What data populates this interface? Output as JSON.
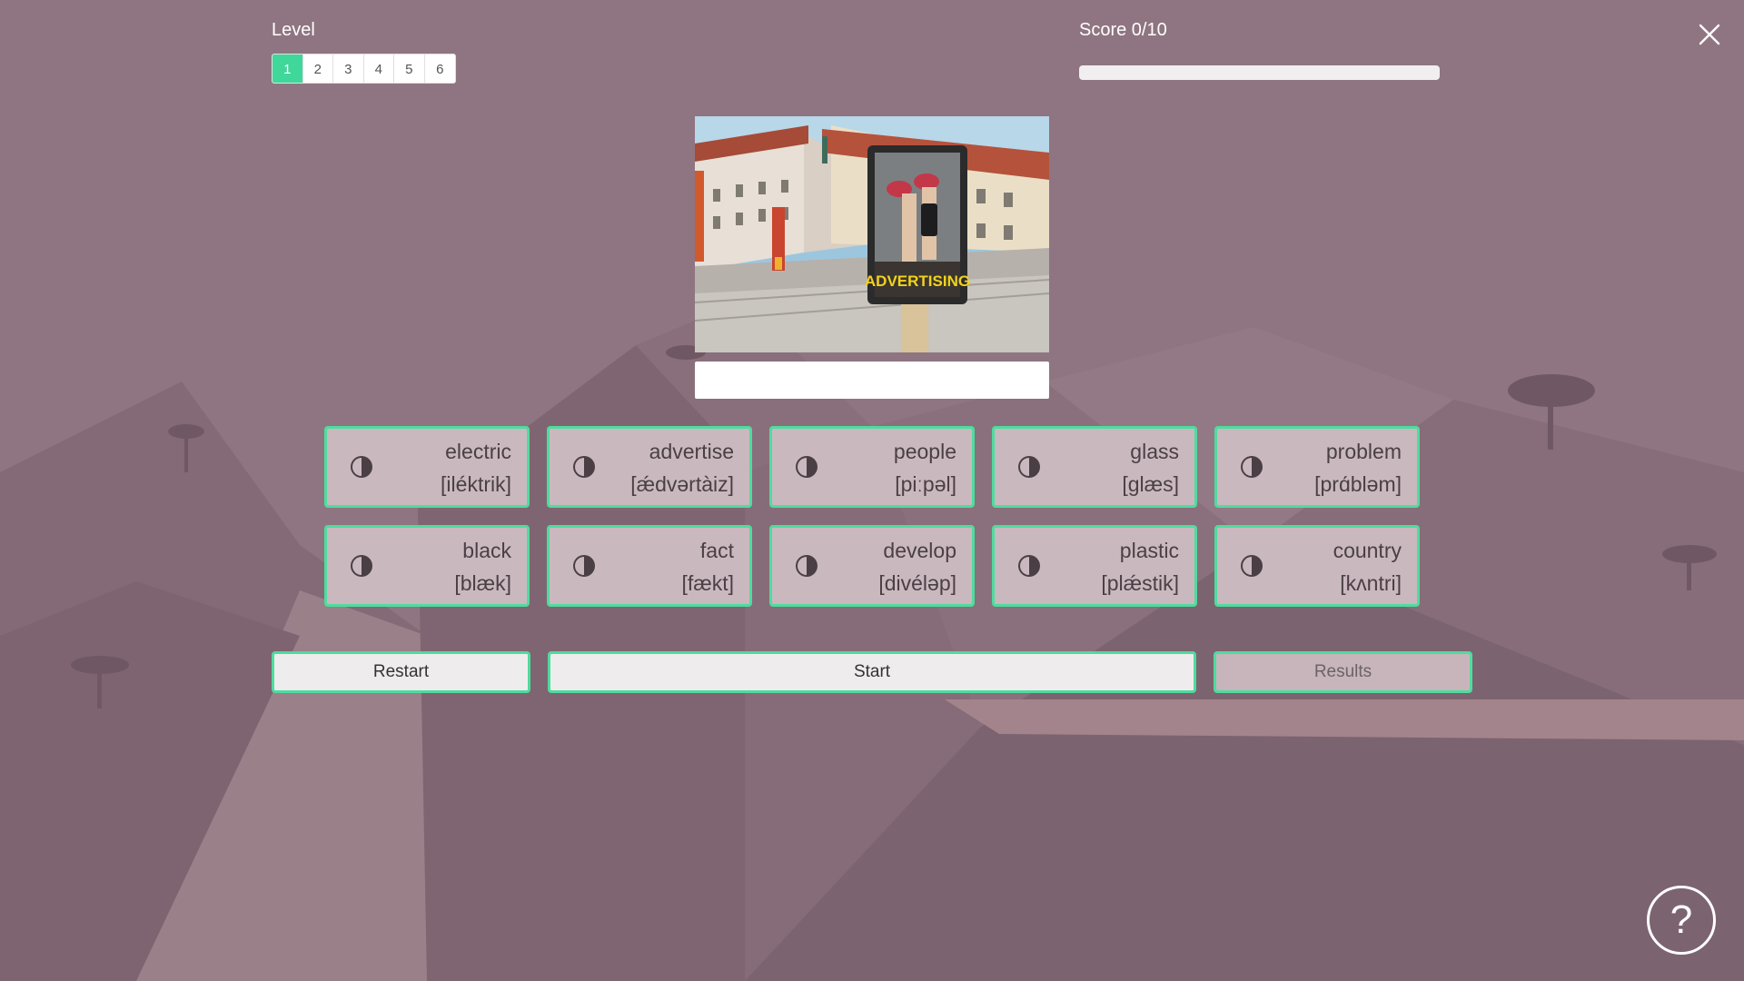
{
  "level": {
    "label": "Level",
    "tabs": [
      "1",
      "2",
      "3",
      "4",
      "5",
      "6"
    ],
    "active_index": 0
  },
  "score": {
    "label": "Score 0/10",
    "progress_fraction": 0
  },
  "photo": {
    "poster_text": "ADVERTISING"
  },
  "answer": {
    "value": "",
    "placeholder": ""
  },
  "words": [
    {
      "word": "electric",
      "ipa": "[iléktrik]"
    },
    {
      "word": "advertise",
      "ipa": "[ǽdvərtàiz]"
    },
    {
      "word": "people",
      "ipa": "[piːpəl]"
    },
    {
      "word": "glass",
      "ipa": "[ɡlæs]"
    },
    {
      "word": "problem",
      "ipa": "[prɑ́bləm]"
    },
    {
      "word": "black",
      "ipa": "[blæk]"
    },
    {
      "word": "fact",
      "ipa": "[fækt]"
    },
    {
      "word": "develop",
      "ipa": "[divéləp]"
    },
    {
      "word": "plastic",
      "ipa": "[plǽstik]"
    },
    {
      "word": "country",
      "ipa": "[kʌntri]"
    }
  ],
  "buttons": {
    "restart": "Restart",
    "start": "Start",
    "results": "Results"
  },
  "help": {
    "label": "?"
  },
  "icons": {
    "close": "close-icon",
    "speaker": "speaker-icon",
    "help": "help-icon"
  },
  "colors": {
    "accent": "#3fd79a",
    "card_border": "#4edc9e",
    "background": "#8f7580"
  }
}
